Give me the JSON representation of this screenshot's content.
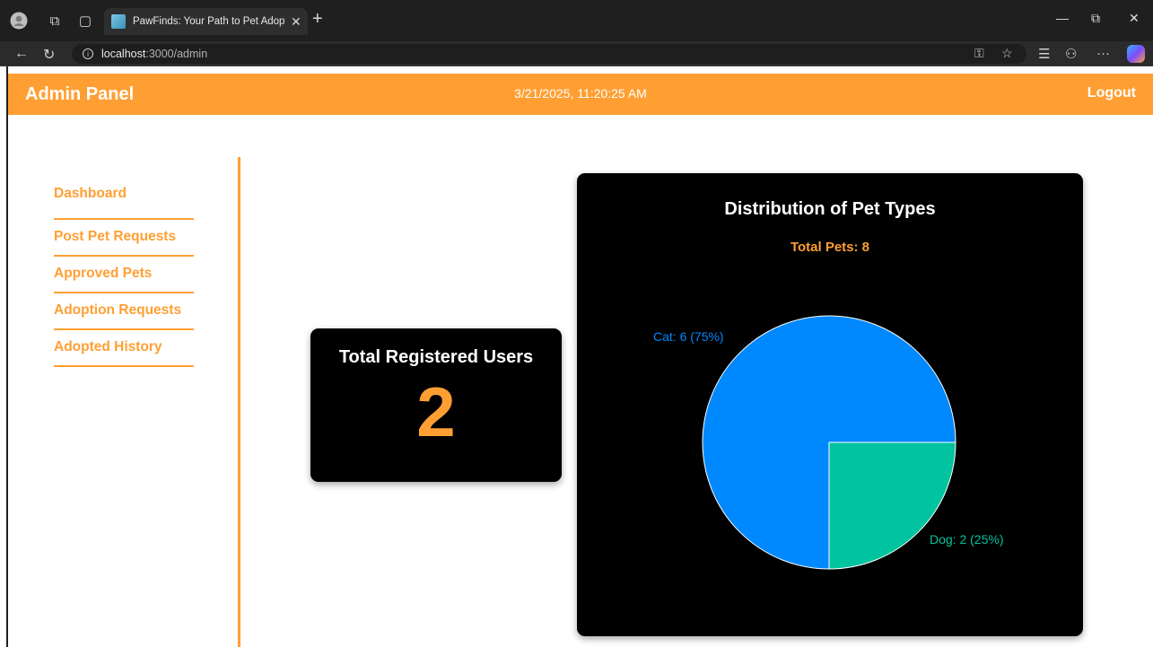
{
  "browser": {
    "tab_title": "PawFinds: Your Path to Pet Adoption",
    "url_host": "localhost",
    "url_path": ":3000/admin"
  },
  "header": {
    "brand": "Admin Panel",
    "clock": "3/21/2025, 11:20:25 AM",
    "logout": "Logout"
  },
  "sidebar": {
    "items": [
      {
        "label": "Dashboard"
      },
      {
        "label": "Post Pet Requests"
      },
      {
        "label": "Approved Pets"
      },
      {
        "label": "Adoption Requests"
      },
      {
        "label": "Adopted History"
      }
    ]
  },
  "users_card": {
    "label": "Total Registered Users",
    "count": "2"
  },
  "colors": {
    "accent": "#ff9f33",
    "card_bg": "#000000",
    "cat": "#0088fe",
    "dog": "#00c49f"
  },
  "chart_data": {
    "type": "pie",
    "title": "Distribution of Pet Types",
    "subtitle": "Total Pets: 8",
    "slices": [
      {
        "name": "Cat",
        "value": 6,
        "label": "Cat: 6 (75%)",
        "color": "#0088fe"
      },
      {
        "name": "Dog",
        "value": 2,
        "label": "Dog: 2 (25%)",
        "color": "#00c49f"
      }
    ]
  }
}
